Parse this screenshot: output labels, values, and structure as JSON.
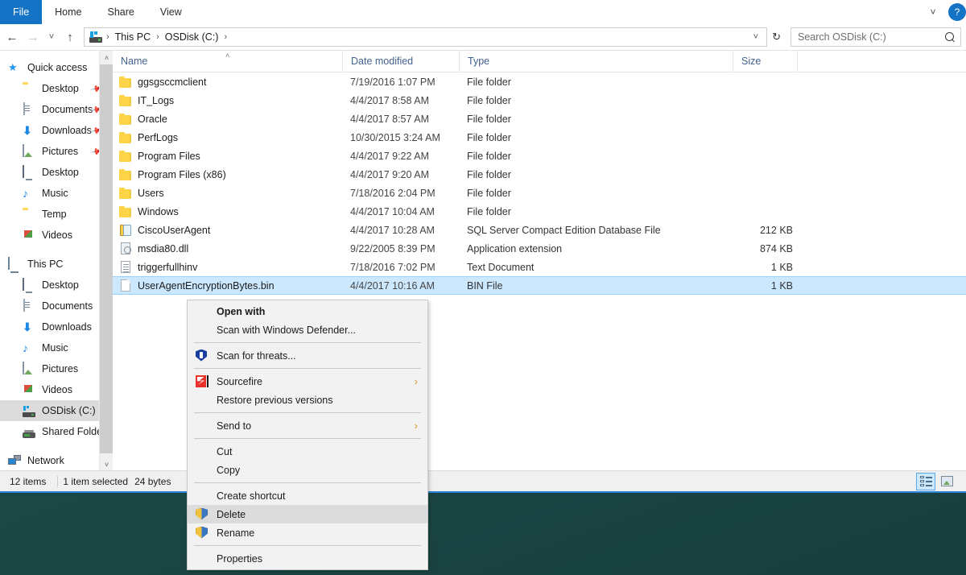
{
  "ribbon": {
    "tabs": [
      {
        "label": "File",
        "active_blue": true
      },
      {
        "label": "Home",
        "active_blue": false
      },
      {
        "label": "Share",
        "active_blue": false
      },
      {
        "label": "View",
        "active_blue": false
      }
    ],
    "minimize_ribbon_icon": "chevron-down-icon",
    "help_label": "?"
  },
  "nav": {
    "back_icon": "back-arrow-icon",
    "forward_icon": "forward-arrow-icon",
    "recent_icon": "chevron-down-icon",
    "up_icon": "up-arrow-icon",
    "breadcrumbs": [
      "This PC",
      "OSDisk (C:)"
    ],
    "refresh_icon": "refresh-icon",
    "dropdown_icon": "chevron-down-icon"
  },
  "search": {
    "placeholder": "Search OSDisk (C:)",
    "value": "",
    "icon": "search-icon"
  },
  "sidebar": {
    "groups": [
      {
        "header": {
          "label": "Quick access",
          "icon": "star-icon"
        },
        "items": [
          {
            "label": "Desktop",
            "icon": "folder-icon",
            "pinned": true
          },
          {
            "label": "Documents",
            "icon": "document-icon",
            "pinned": true
          },
          {
            "label": "Downloads",
            "icon": "download-icon",
            "pinned": true
          },
          {
            "label": "Pictures",
            "icon": "picture-icon",
            "pinned": true
          },
          {
            "label": "Desktop",
            "icon": "monitor-icon",
            "pinned": false
          },
          {
            "label": "Music",
            "icon": "music-icon",
            "pinned": false
          },
          {
            "label": "Temp",
            "icon": "folder-icon",
            "pinned": false
          },
          {
            "label": "Videos",
            "icon": "video-icon",
            "pinned": false
          }
        ]
      },
      {
        "header": {
          "label": "This PC",
          "icon": "computer-icon"
        },
        "items": [
          {
            "label": "Desktop",
            "icon": "monitor-icon",
            "pinned": false
          },
          {
            "label": "Documents",
            "icon": "document-icon",
            "pinned": false
          },
          {
            "label": "Downloads",
            "icon": "download-icon",
            "pinned": false
          },
          {
            "label": "Music",
            "icon": "music-icon",
            "pinned": false
          },
          {
            "label": "Pictures",
            "icon": "picture-icon",
            "pinned": false
          },
          {
            "label": "Videos",
            "icon": "video-icon",
            "pinned": false
          },
          {
            "label": "OSDisk (C:)",
            "icon": "drive-icon",
            "pinned": false,
            "selected": true
          },
          {
            "label": "Shared Folders (\\",
            "icon": "network-drive-icon",
            "pinned": false
          }
        ]
      },
      {
        "header": {
          "label": "Network",
          "icon": "network-icon"
        },
        "items": []
      }
    ],
    "scrollbar": {
      "up_icon": "chevron-up-icon",
      "down_icon": "chevron-down-icon"
    }
  },
  "columns": {
    "name": "Name",
    "date_modified": "Date modified",
    "type": "Type",
    "size": "Size",
    "sort_indicator": "ascending-caret-icon"
  },
  "files": [
    {
      "name": "ggsgsccmclient",
      "date": "7/19/2016 1:07 PM",
      "type": "File folder",
      "size": "",
      "icon": "folder-icon",
      "selected": false
    },
    {
      "name": "IT_Logs",
      "date": "4/4/2017 8:58 AM",
      "type": "File folder",
      "size": "",
      "icon": "folder-icon",
      "selected": false
    },
    {
      "name": "Oracle",
      "date": "4/4/2017 8:57 AM",
      "type": "File folder",
      "size": "",
      "icon": "folder-icon",
      "selected": false
    },
    {
      "name": "PerfLogs",
      "date": "10/30/2015 3:24 AM",
      "type": "File folder",
      "size": "",
      "icon": "folder-icon",
      "selected": false
    },
    {
      "name": "Program Files",
      "date": "4/4/2017 9:22 AM",
      "type": "File folder",
      "size": "",
      "icon": "folder-icon",
      "selected": false
    },
    {
      "name": "Program Files (x86)",
      "date": "4/4/2017 9:20 AM",
      "type": "File folder",
      "size": "",
      "icon": "folder-icon",
      "selected": false
    },
    {
      "name": "Users",
      "date": "7/18/2016 2:04 PM",
      "type": "File folder",
      "size": "",
      "icon": "folder-icon",
      "selected": false
    },
    {
      "name": "Windows",
      "date": "4/4/2017 10:04 AM",
      "type": "File folder",
      "size": "",
      "icon": "folder-icon",
      "selected": false
    },
    {
      "name": "CiscoUserAgent",
      "date": "4/4/2017 10:28 AM",
      "type": "SQL Server Compact Edition Database File",
      "size": "212 KB",
      "icon": "database-file-icon",
      "selected": false
    },
    {
      "name": "msdia80.dll",
      "date": "9/22/2005 8:39 PM",
      "type": "Application extension",
      "size": "874 KB",
      "icon": "dll-file-icon",
      "selected": false
    },
    {
      "name": "triggerfullhinv",
      "date": "7/18/2016 7:02 PM",
      "type": "Text Document",
      "size": "1 KB",
      "icon": "text-file-icon",
      "selected": false
    },
    {
      "name": "UserAgentEncryptionBytes.bin",
      "date": "4/4/2017 10:16 AM",
      "type": "BIN File",
      "size": "1 KB",
      "icon": "bin-file-icon",
      "selected": true
    }
  ],
  "context_menu": {
    "items": [
      {
        "label": "Open with",
        "bold": true,
        "icon": "",
        "arrow": false,
        "highlighted": false,
        "separator_after": false
      },
      {
        "label": "Scan with Windows Defender...",
        "bold": false,
        "icon": "",
        "arrow": false,
        "highlighted": false,
        "separator_after": true
      },
      {
        "label": "Scan for threats...",
        "bold": false,
        "icon": "shield-blue-icon",
        "arrow": false,
        "highlighted": false,
        "separator_after": true
      },
      {
        "label": "Sourcefire",
        "bold": false,
        "icon": "sourcefire-icon",
        "arrow": true,
        "highlighted": false,
        "separator_after": false
      },
      {
        "label": "Restore previous versions",
        "bold": false,
        "icon": "",
        "arrow": false,
        "highlighted": false,
        "separator_after": true
      },
      {
        "label": "Send to",
        "bold": false,
        "icon": "",
        "arrow": true,
        "highlighted": false,
        "separator_after": true
      },
      {
        "label": "Cut",
        "bold": false,
        "icon": "",
        "arrow": false,
        "highlighted": false,
        "separator_after": false
      },
      {
        "label": "Copy",
        "bold": false,
        "icon": "",
        "arrow": false,
        "highlighted": false,
        "separator_after": true
      },
      {
        "label": "Create shortcut",
        "bold": false,
        "icon": "",
        "arrow": false,
        "highlighted": false,
        "separator_after": false
      },
      {
        "label": "Delete",
        "bold": false,
        "icon": "uac-shield-icon",
        "arrow": false,
        "highlighted": true,
        "separator_after": false
      },
      {
        "label": "Rename",
        "bold": false,
        "icon": "uac-shield-icon",
        "arrow": false,
        "highlighted": false,
        "separator_after": true
      },
      {
        "label": "Properties",
        "bold": false,
        "icon": "",
        "arrow": false,
        "highlighted": false,
        "separator_after": false
      }
    ]
  },
  "status": {
    "item_count": "12 items",
    "selection": "1 item selected",
    "selection_size": "24 bytes",
    "view_details_icon": "details-view-icon",
    "view_icons_icon": "large-icons-view-icon"
  },
  "colors": {
    "accent": "#1573c6",
    "selection": "#cce8ff",
    "file_tab": "#1573c6",
    "desktop": "#1d4b49"
  }
}
